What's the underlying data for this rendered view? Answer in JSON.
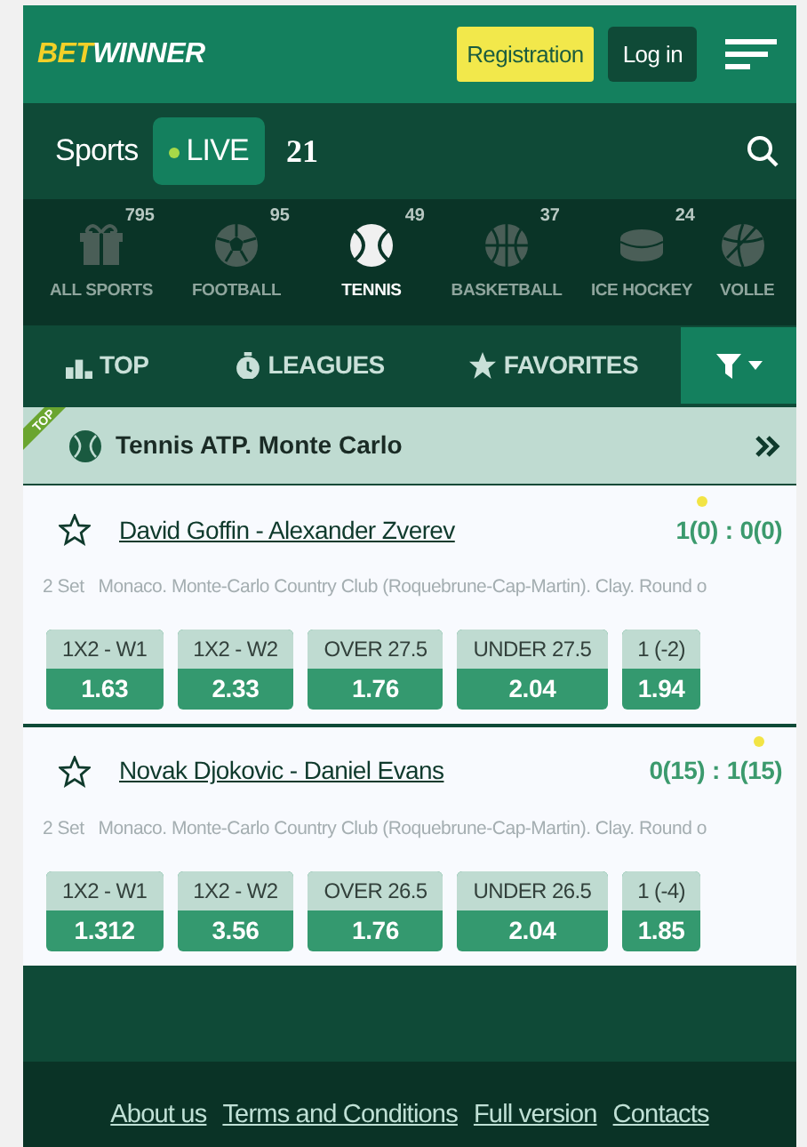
{
  "header": {
    "logo_part1": "BET",
    "logo_part2": "WINNER",
    "buttons": [
      {
        "label": "Registration",
        "kind": "register"
      },
      {
        "label": "Log in",
        "kind": "login"
      }
    ]
  },
  "sports_bar": {
    "title": "Sports",
    "live_label": "LIVE",
    "live_count": "21"
  },
  "sports": [
    {
      "label": "ALL SPORTS",
      "count": "795",
      "kind": "gift",
      "selected": false
    },
    {
      "label": "FOOTBALL",
      "count": "95",
      "kind": "football",
      "selected": false
    },
    {
      "label": "TENNIS",
      "count": "49",
      "kind": "tennis",
      "selected": true
    },
    {
      "label": "BASKETBALL",
      "count": "37",
      "kind": "basketball",
      "selected": false
    },
    {
      "label": "ICE HOCKEY",
      "count": "24",
      "kind": "hockey",
      "selected": false
    },
    {
      "label": "VOLLE",
      "kind": "volleyball",
      "selected": false
    }
  ],
  "tabs": [
    {
      "label": "TOP",
      "kind": "top"
    },
    {
      "label": "LEAGUES",
      "kind": "leagues"
    },
    {
      "label": "FAVORITES",
      "kind": "favorites"
    }
  ],
  "league": {
    "ribbon": "TOP",
    "title": "Tennis ATP. Monte Carlo"
  },
  "matches": [
    {
      "teams": "David Goffin - Alexander Zverev",
      "score_home": "1(0)",
      "score_separator": ":",
      "score_away": "0(0)",
      "serving_home": true,
      "serving_away": false,
      "period": "2 Set",
      "venue": "Monaco. Monte-Carlo Country Club (Roquebrune-Cap-Martin). Clay. Round o",
      "odds": [
        {
          "market": "1X2 - W1",
          "value": "1.63"
        },
        {
          "market": "1X2 - W2",
          "value": "2.33"
        },
        {
          "market": "OVER 27.5",
          "value": "1.76"
        },
        {
          "market": "UNDER 27.5",
          "value": "2.04"
        },
        {
          "market": "1 (-2)",
          "value": "1.94"
        }
      ]
    },
    {
      "teams": "Novak Djokovic - Daniel Evans",
      "score_home": "0(15)",
      "score_separator": ":",
      "score_away": "1(15)",
      "serving_home": false,
      "serving_away": true,
      "period": "2 Set",
      "venue": "Monaco. Monte-Carlo Country Club (Roquebrune-Cap-Martin). Clay. Round o",
      "odds": [
        {
          "market": "1X2 - W1",
          "value": "1.312"
        },
        {
          "market": "1X2 - W2",
          "value": "3.56"
        },
        {
          "market": "OVER 26.5",
          "value": "1.76"
        },
        {
          "market": "UNDER 26.5",
          "value": "2.04"
        },
        {
          "market": "1 (-4)",
          "value": "1.85"
        }
      ]
    }
  ],
  "footer_links": [
    "About us",
    "Terms and Conditions",
    "Full version",
    "Contacts"
  ]
}
